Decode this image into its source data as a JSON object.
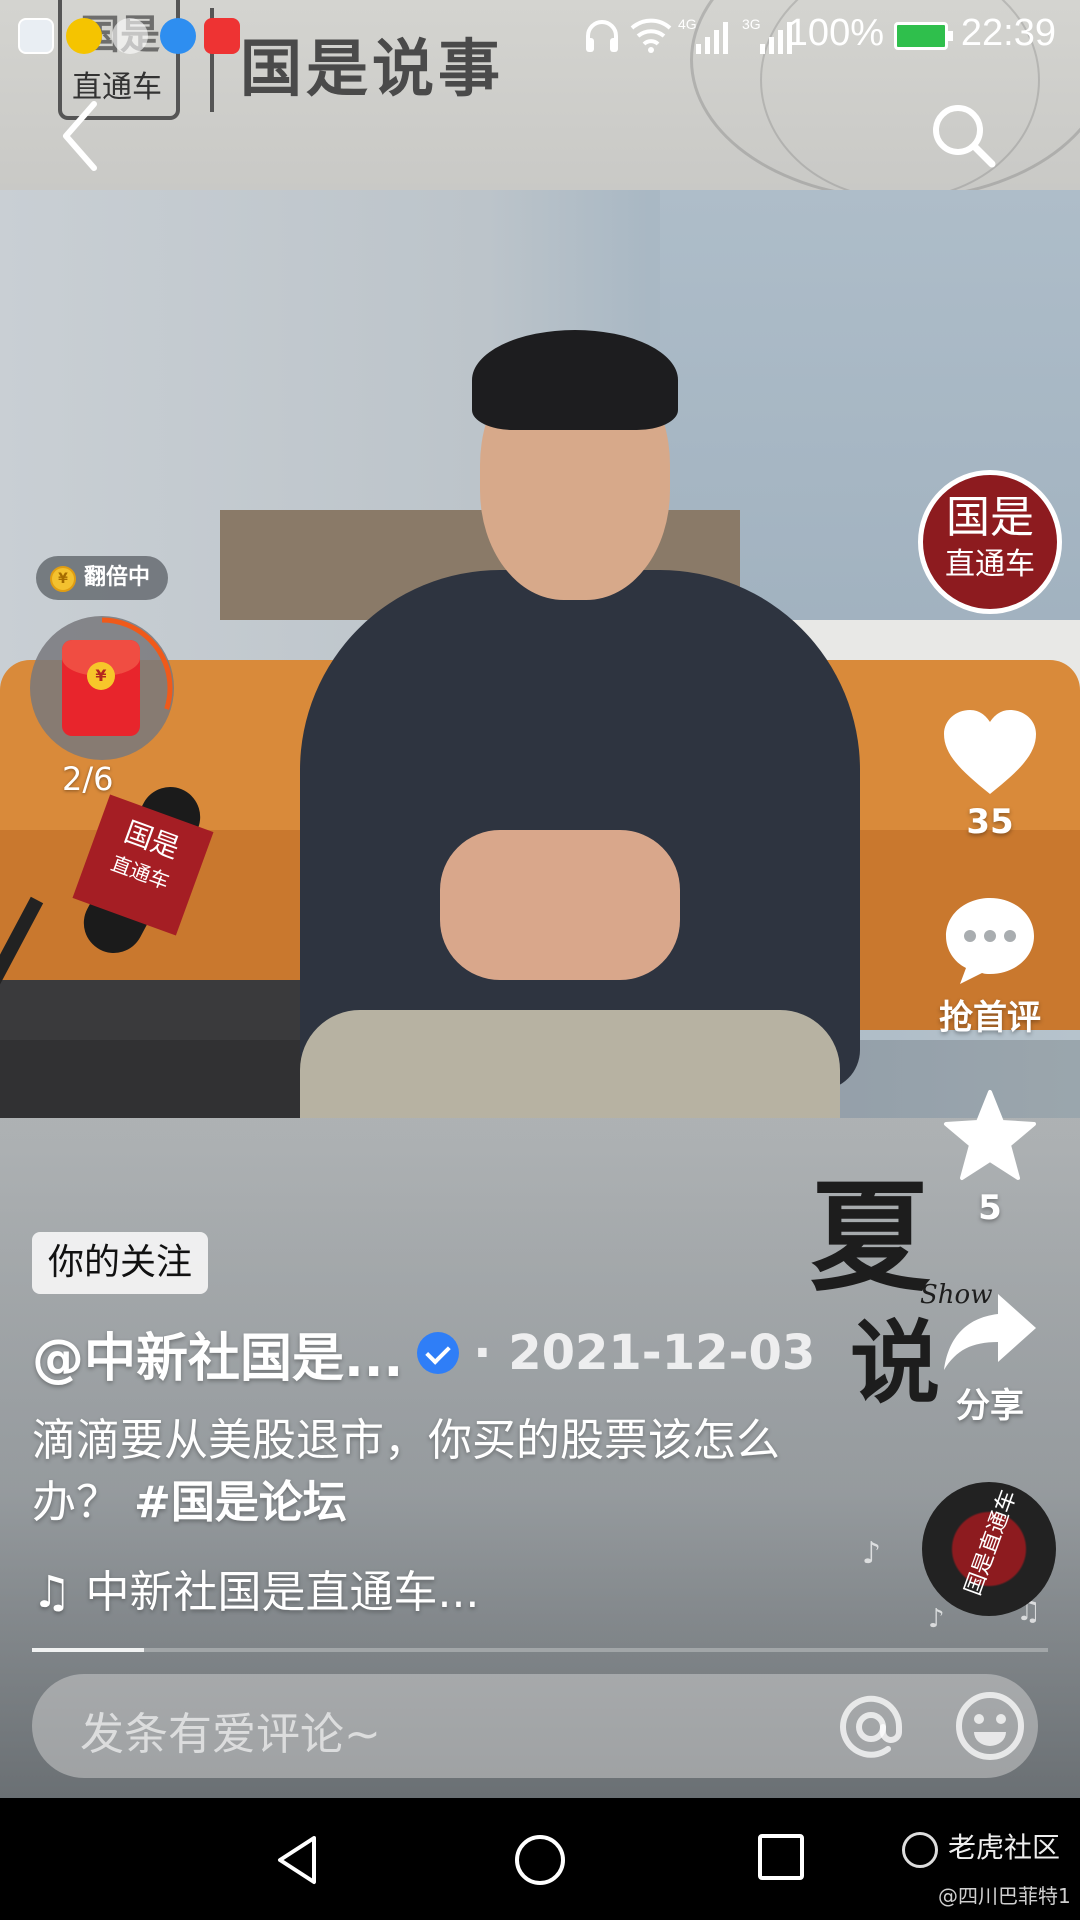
{
  "status_bar": {
    "network_4g": "4G",
    "network_3g": "3G",
    "battery_percent": "100%",
    "time": "22:39"
  },
  "banner": {
    "logo_line1": "国是",
    "logo_line2": "直通车",
    "title": "国是说事"
  },
  "video_scene": {
    "mic_flag_line1": "国是",
    "mic_flag_line2": "直通车"
  },
  "red_packet": {
    "badge_label": "翻倍中",
    "progress": "2/6",
    "ring_progress_fraction": 0.3
  },
  "author": {
    "avatar_line1": "国是",
    "avatar_line2": "直通车",
    "name": "@中新社国是...",
    "date": "· 2021-12-03",
    "follow_tag": "你的关注"
  },
  "actions": {
    "like_count": "35",
    "comment_label": "抢首评",
    "favorite_count": "5",
    "share_label": "分享"
  },
  "watermark": {
    "char1": "夏",
    "char2": "说",
    "latin": "Show"
  },
  "caption": {
    "text": "滴滴要从美股退市，你买的股票该怎么办？ ",
    "hashtag": "#国是论坛"
  },
  "music": {
    "note_glyph": "♫",
    "title": "中新社国是直通车...",
    "disc_label": "国是直通车"
  },
  "playback": {
    "progress_fraction": 0.11
  },
  "comment_box": {
    "placeholder": "发条有爱评论~"
  },
  "footer_watermark": {
    "site": "老虎社区",
    "user": "@四川巴菲特1"
  },
  "colors": {
    "avatar_red": "#8d1b1f",
    "verified_blue": "#2f7ef7",
    "packet_red": "#e8252c",
    "ring_orange": "#f05a1a"
  }
}
